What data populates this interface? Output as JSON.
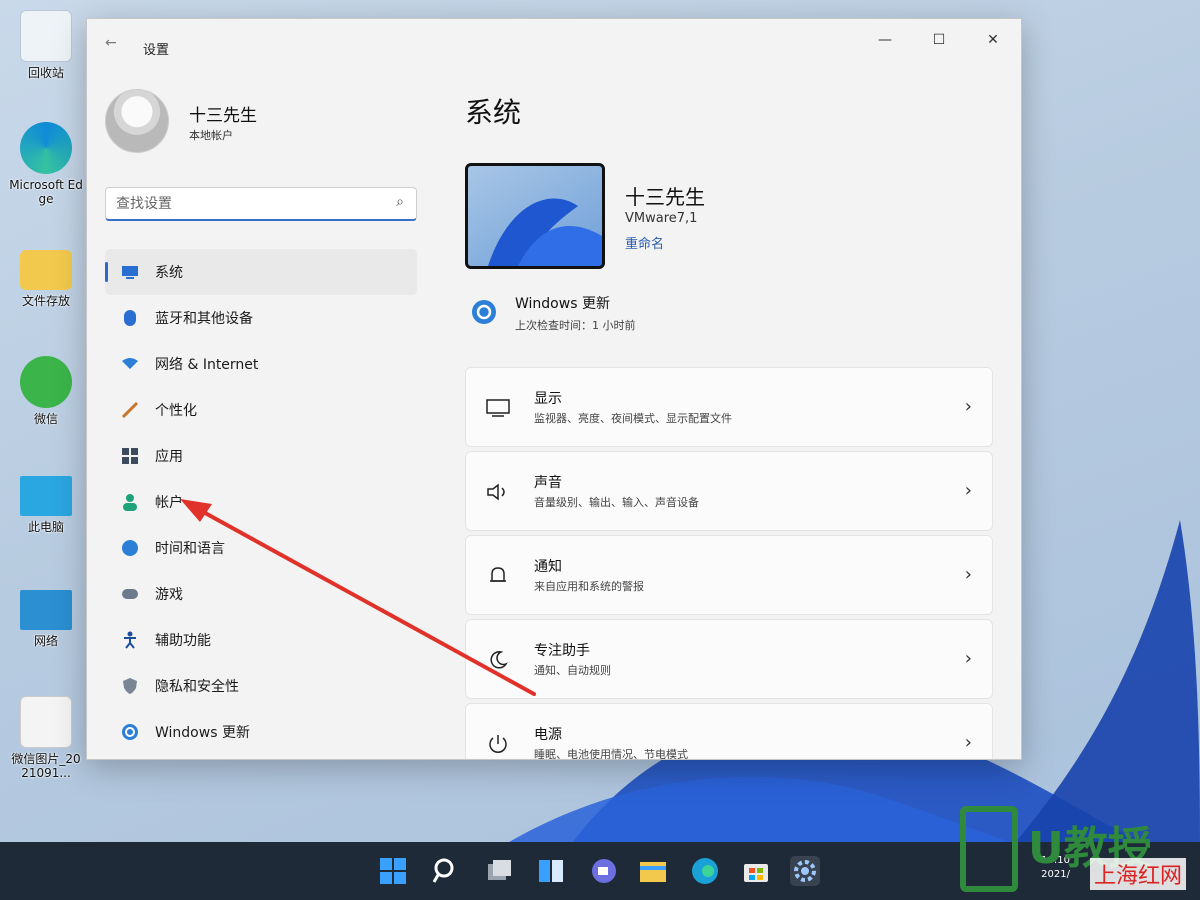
{
  "desktop": {
    "icons": [
      {
        "label": "回收站",
        "icon": "recycle-bin-icon"
      },
      {
        "label": "Microsoft Edge",
        "icon": "edge-icon"
      },
      {
        "label": "文件存放",
        "icon": "folder-icon"
      },
      {
        "label": "微信",
        "icon": "wechat-icon"
      },
      {
        "label": "此电脑",
        "icon": "computer-icon"
      },
      {
        "label": "网络",
        "icon": "network-icon"
      },
      {
        "label": "微信图片_2021091...",
        "icon": "image-file-icon"
      }
    ]
  },
  "window": {
    "title": "设置",
    "back_icon": "←",
    "min_icon": "—",
    "max_icon": "☐",
    "close_icon": "✕"
  },
  "profile": {
    "name": "十三先生",
    "type": "本地帐户"
  },
  "search": {
    "placeholder": "查找设置",
    "icon": "⌕"
  },
  "nav": {
    "items": [
      {
        "label": "系统",
        "icon": "monitor-icon",
        "active": true
      },
      {
        "label": "蓝牙和其他设备",
        "icon": "bluetooth-icon"
      },
      {
        "label": "网络 & Internet",
        "icon": "wifi-icon"
      },
      {
        "label": "个性化",
        "icon": "brush-icon"
      },
      {
        "label": "应用",
        "icon": "apps-icon"
      },
      {
        "label": "帐户",
        "icon": "account-icon"
      },
      {
        "label": "时间和语言",
        "icon": "globe-clock-icon"
      },
      {
        "label": "游戏",
        "icon": "gamepad-icon"
      },
      {
        "label": "辅助功能",
        "icon": "accessibility-icon"
      },
      {
        "label": "隐私和安全性",
        "icon": "shield-icon"
      },
      {
        "label": "Windows 更新",
        "icon": "update-icon"
      }
    ]
  },
  "main": {
    "heading": "系统",
    "device": {
      "name": "十三先生",
      "model": "VMware7,1",
      "rename": "重命名"
    },
    "windows_update": {
      "title": "Windows 更新",
      "subtitle": "上次检查时间：1 小时前"
    },
    "cards": [
      {
        "title": "显示",
        "subtitle": "监视器、亮度、夜间模式、显示配置文件",
        "icon": "display-icon"
      },
      {
        "title": "声音",
        "subtitle": "音量级别、输出、输入、声音设备",
        "icon": "speaker-icon"
      },
      {
        "title": "通知",
        "subtitle": "来自应用和系统的警报",
        "icon": "bell-icon"
      },
      {
        "title": "专注助手",
        "subtitle": "通知、自动规则",
        "icon": "moon-icon"
      },
      {
        "title": "电源",
        "subtitle": "睡眠、电池使用情况、节电模式",
        "icon": "power-icon"
      }
    ],
    "chevron": "›"
  },
  "taskbar": {
    "icons": [
      "start-icon",
      "search-icon",
      "task-view-icon",
      "widgets-icon",
      "chat-icon",
      "file-explorer-icon",
      "edge-icon",
      "store-icon",
      "settings-icon"
    ],
    "time": "10:10",
    "date": "2021/"
  },
  "watermark": {
    "brand": "U教授",
    "site": "上海红网"
  },
  "colors": {
    "accent": "#3167c4",
    "arrow": "#e0322a",
    "brand_green": "#2f8a3d"
  }
}
